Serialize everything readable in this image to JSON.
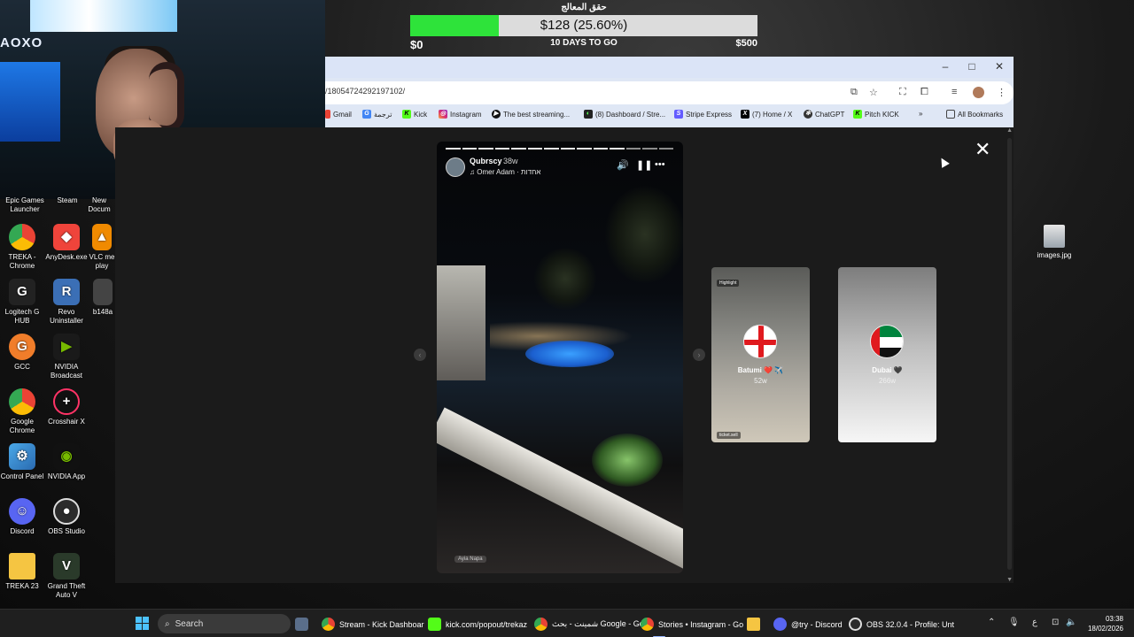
{
  "donation_goal": {
    "title": "حقق المعالج",
    "amount_label": "$128 (25.60%)",
    "progress_fraction": 0.256,
    "min_label": "$0",
    "days_label": "10 DAYS TO GO",
    "max_label": "$500"
  },
  "webcam": {
    "logo_text": "AOXO"
  },
  "desktop_icons": [
    {
      "label": "Epic Games Launcher"
    },
    {
      "label": "Steam"
    },
    {
      "label": "New Docum"
    },
    {
      "label": "TREKA - Chrome"
    },
    {
      "label": "AnyDesk.exe"
    },
    {
      "label": "VLC me play"
    },
    {
      "label": "Logitech G HUB"
    },
    {
      "label": "Revo Uninstaller"
    },
    {
      "label": "b148a"
    },
    {
      "label": "GCC"
    },
    {
      "label": "NVIDIA Broadcast"
    },
    {
      "label": "Google Chrome"
    },
    {
      "label": "Crosshair X"
    },
    {
      "label": "Control Panel"
    },
    {
      "label": "NVIDIA App"
    },
    {
      "label": "Discord"
    },
    {
      "label": "OBS Studio"
    },
    {
      "label": "TREKA 23"
    },
    {
      "label": "Grand Theft Auto V"
    }
  ],
  "desktop_file": {
    "label": "images.jpg"
  },
  "browser": {
    "url": "/18054724292197102/",
    "bookmarks": [
      {
        "label": "Gmail"
      },
      {
        "label": "ترجمة"
      },
      {
        "label": "Kick"
      },
      {
        "label": "Instagram"
      },
      {
        "label": "The best streaming..."
      },
      {
        "label": "(8) Dashboard / Stre..."
      },
      {
        "label": "Stripe Express"
      },
      {
        "label": "(7) Home / X"
      },
      {
        "label": "ChatGPT"
      },
      {
        "label": "Pitch KICK"
      },
      {
        "label": "All Bookmarks"
      }
    ],
    "more_bookmarks": "»"
  },
  "story": {
    "username": "Qubrscy",
    "time_ago": "38w",
    "music": "Omer Adam · אחדות",
    "location_tag": "Ayia Napa",
    "segments_total": 14,
    "segments_done": 11
  },
  "previews": [
    {
      "title": "Batumi ❤️ ✈️",
      "age": "52w",
      "tag_top": "Highlight",
      "tag_bottom": "ticket.sell"
    },
    {
      "title": "Dubai 🖤",
      "age": "266w"
    }
  ],
  "taskbar": {
    "search_placeholder": "Search",
    "items": [
      {
        "label": "Stream - Kick Dashboar"
      },
      {
        "label": "kick.com/popout/trekaz"
      },
      {
        "label": "شمينت - بحث Google - Go"
      },
      {
        "label": "Stories • Instagram - Go"
      },
      {
        "label": "@try - Discord"
      },
      {
        "label": "OBS 32.0.4 - Profile: Unt"
      }
    ],
    "lang": "ع",
    "time": "03:38",
    "date": "18/02/2026"
  }
}
